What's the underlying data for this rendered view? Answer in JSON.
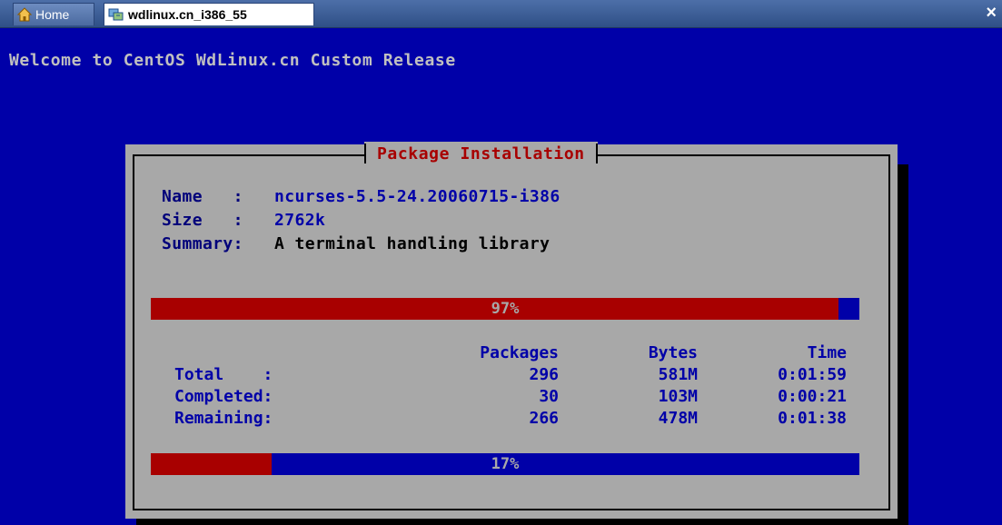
{
  "tabs": [
    {
      "label": "Home",
      "icon": "home-icon"
    },
    {
      "label": "wdlinux.cn_i386_55",
      "icon": "vm-icon"
    }
  ],
  "close_label": "×",
  "welcome": "Welcome to CentOS WdLinux.cn Custom Release",
  "dialog": {
    "title": "Package Installation",
    "info": {
      "name_label": "Name   :",
      "name_value": "ncurses-5.5-24.20060715-i386",
      "size_label": "Size   :",
      "size_value": "2762k",
      "summary_label": "Summary:",
      "summary_value": "A terminal handling library"
    },
    "package_progress": {
      "label": "97%",
      "fraction": 0.97
    },
    "table": {
      "headers": [
        "Packages",
        "Bytes",
        "Time"
      ],
      "rows": [
        {
          "label": "Total    :",
          "packages": "296",
          "bytes": "581M",
          "time": "0:01:59"
        },
        {
          "label": "Completed:",
          "packages": "30",
          "bytes": "103M",
          "time": "0:00:21"
        },
        {
          "label": "Remaining:",
          "packages": "266",
          "bytes": "478M",
          "time": "0:01:38"
        }
      ]
    },
    "total_progress": {
      "label": "17%",
      "fraction": 0.17
    }
  },
  "colors": {
    "terminal_bg": "#0000a8",
    "dialog_bg": "#a8a8a8",
    "title_red": "#a80000",
    "bar_fill": "#a80000",
    "text_blue": "#0000a8"
  }
}
